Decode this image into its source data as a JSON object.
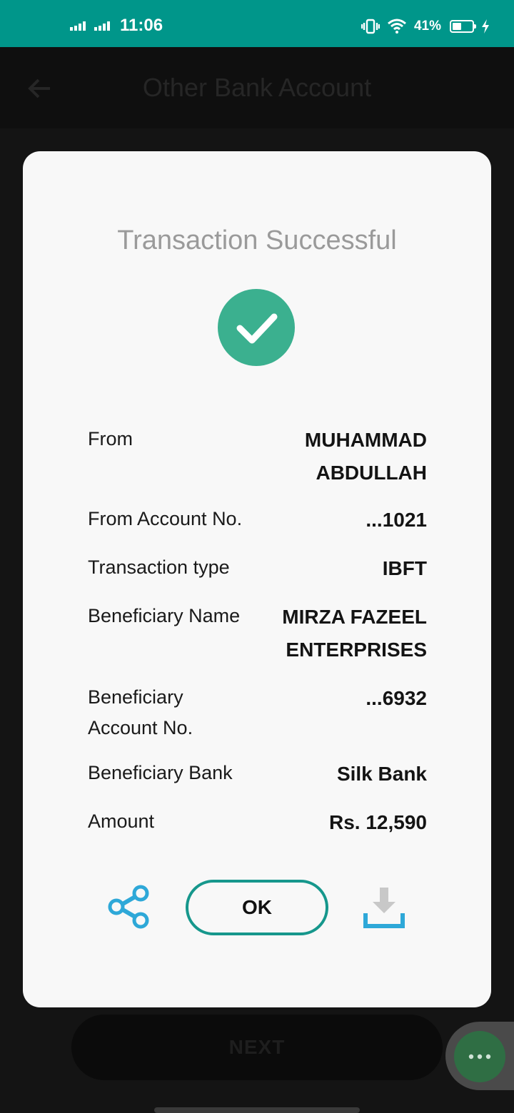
{
  "status_bar": {
    "time": "11:06",
    "battery": "41%"
  },
  "app_bar": {
    "title": "Other Bank Account"
  },
  "dialog": {
    "title": "Transaction  Successful",
    "details": [
      {
        "label": "From",
        "value": "MUHAMMAD ABDULLAH"
      },
      {
        "label": "From Account No.",
        "value": "...1021"
      },
      {
        "label": "Transaction type",
        "value": "IBFT"
      },
      {
        "label": "Beneficiary Name",
        "value": "MIRZA FAZEEL ENTERPRISES"
      },
      {
        "label": "Beneficiary Account No.",
        "value": "...6932"
      },
      {
        "label": "Beneficiary Bank",
        "value": "Silk Bank"
      },
      {
        "label": "Amount",
        "value": "Rs. 12,590"
      }
    ],
    "ok_label": "OK"
  },
  "bottom": {
    "next_label": "NEXT"
  },
  "colors": {
    "accent": "#16978c",
    "success": "#3bb08f",
    "share": "#2ea8d8",
    "status_bar": "#00968a"
  },
  "icons": [
    "back-arrow-icon",
    "success-check-icon",
    "share-icon",
    "download-icon",
    "more-icon",
    "wifi-icon",
    "vibrate-icon",
    "battery-icon",
    "charging-icon"
  ]
}
